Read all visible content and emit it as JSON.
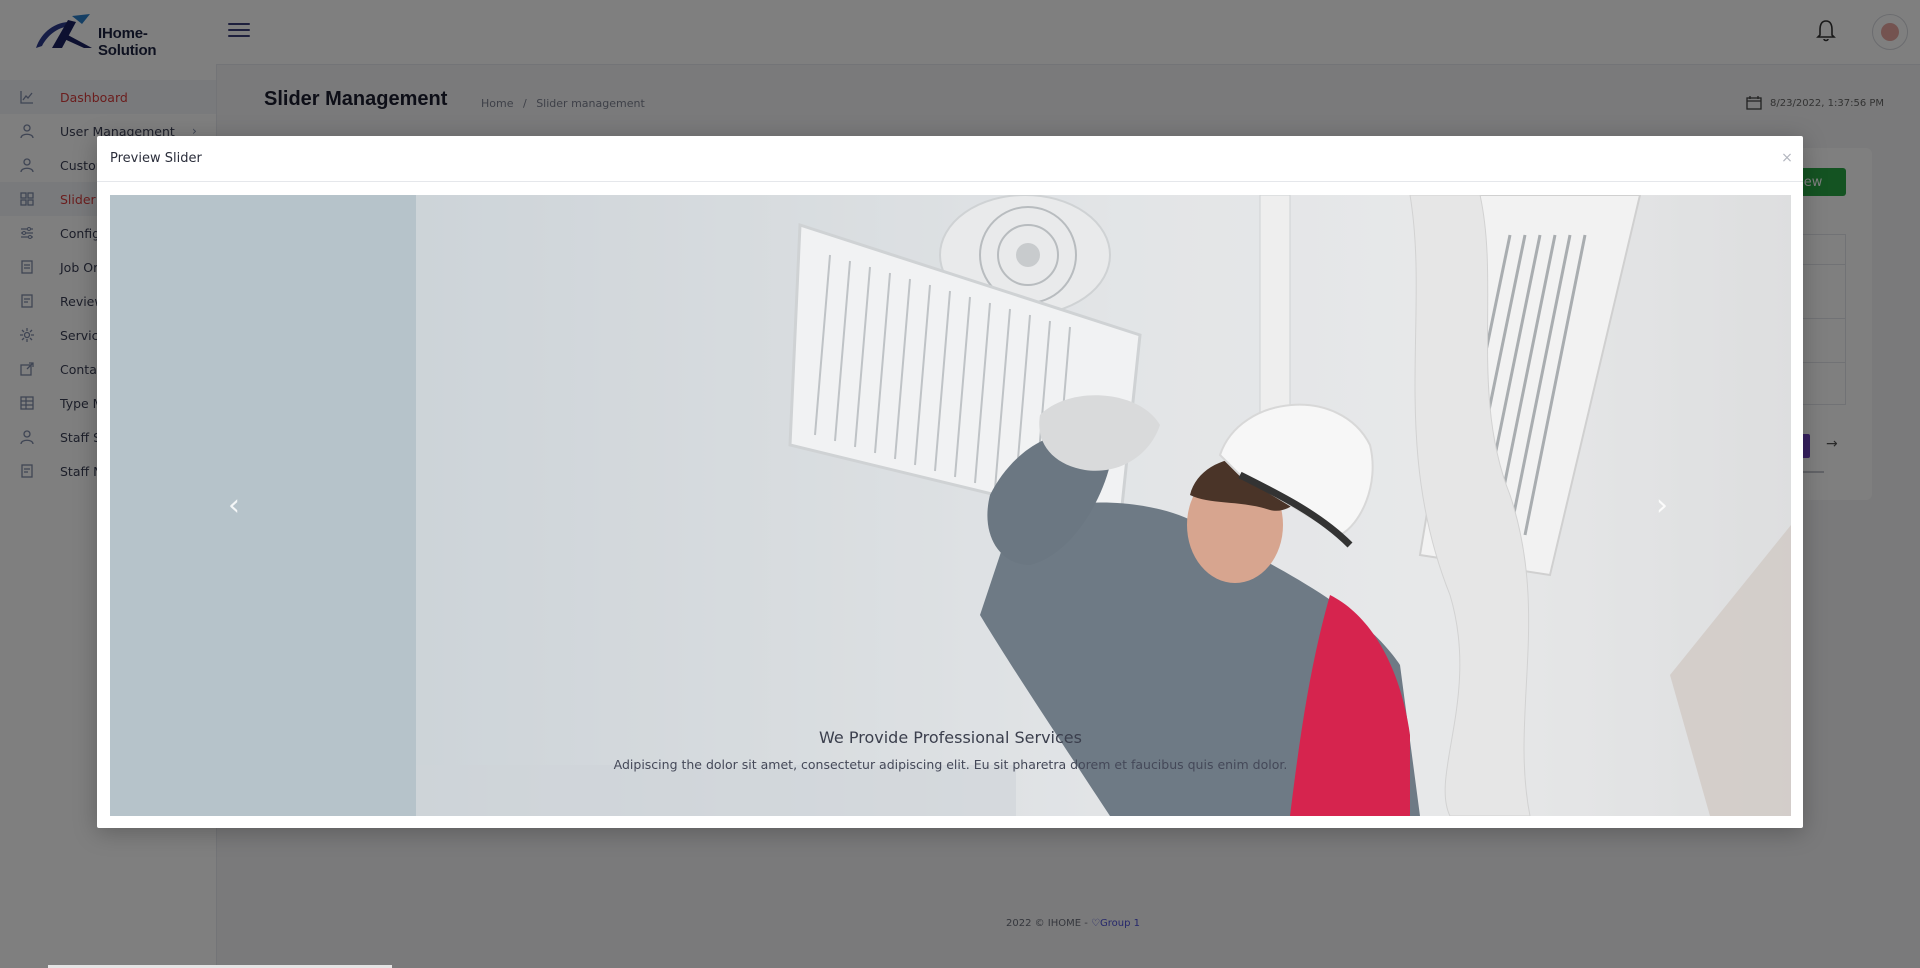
{
  "app": {
    "logo_text": "IHome-Solution"
  },
  "sidebar": {
    "items": [
      {
        "label": "Dashboard",
        "icon": "chart-line-icon",
        "active": true
      },
      {
        "label": "User Management",
        "icon": "user-icon"
      },
      {
        "label": "Custom",
        "icon": "user-icon"
      },
      {
        "label": "Slider C",
        "icon": "grid-icon",
        "active": true
      },
      {
        "label": "Config",
        "icon": "sliders-icon"
      },
      {
        "label": "Job Or",
        "icon": "clipboard-icon"
      },
      {
        "label": "Review",
        "icon": "document-icon"
      },
      {
        "label": "Service",
        "icon": "gear-icon"
      },
      {
        "label": "Contac",
        "icon": "external-link-icon"
      },
      {
        "label": "Type M",
        "icon": "table-icon"
      },
      {
        "label": "Staff S",
        "icon": "user-icon"
      },
      {
        "label": "Staff N",
        "icon": "document-icon"
      }
    ]
  },
  "page": {
    "title": "Slider Management",
    "breadcrumb": [
      "Home",
      "/",
      "Slider management"
    ],
    "datetime": "8/23/2022, 1:37:56 PM",
    "add_button": "new"
  },
  "footer": {
    "text": "2022 © IHOME - ",
    "group": "Group 1"
  },
  "modal": {
    "title": "Preview Slider",
    "close_icon": "×",
    "slide": {
      "title": "We Provide Professional Services",
      "text": "Adipiscing the dolor sit amet, consectetur adipiscing elit. Eu sit pharetra dorem et faucibus quis enim dolor."
    },
    "prev_icon": "‹",
    "next_icon": "›"
  },
  "colors": {
    "accent": "#d63c3c",
    "success": "#28a745",
    "primary": "#6f42c1"
  }
}
